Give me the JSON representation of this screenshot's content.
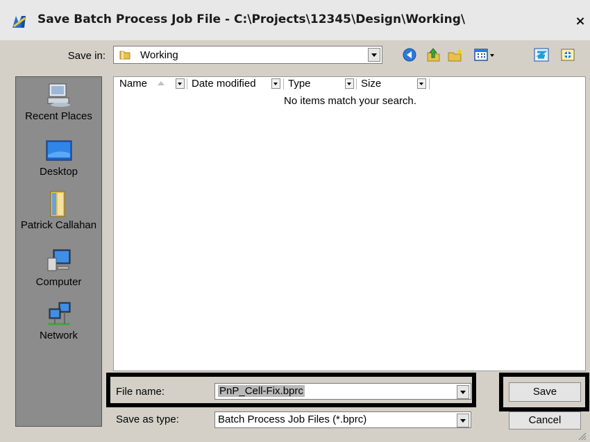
{
  "window": {
    "title": "Save Batch Process Job File - C:\\Projects\\12345\\Design\\Working\\",
    "close_label": "×"
  },
  "save_in": {
    "label": "Save in:",
    "value": "Working"
  },
  "toolbar": {
    "icons": [
      "back-icon",
      "up-folder-icon",
      "new-folder-icon",
      "view-menu-icon",
      "refresh-icon",
      "settings-icon"
    ]
  },
  "places": [
    {
      "label": "Recent Places",
      "icon": "recent-places-icon"
    },
    {
      "label": "Desktop",
      "icon": "desktop-icon"
    },
    {
      "label": "Patrick Callahan",
      "icon": "user-folder-icon"
    },
    {
      "label": "Computer",
      "icon": "computer-icon"
    },
    {
      "label": "Network",
      "icon": "network-icon"
    }
  ],
  "file_list": {
    "columns": [
      "Name",
      "Date modified",
      "Type",
      "Size"
    ],
    "empty_message": "No items match your search."
  },
  "file_name": {
    "label": "File name:",
    "value": "PnP_Cell-Fix.bprc"
  },
  "save_as_type": {
    "label": "Save as type:",
    "value": "Batch Process Job Files (*.bprc)"
  },
  "buttons": {
    "save": "Save",
    "cancel": "Cancel"
  }
}
